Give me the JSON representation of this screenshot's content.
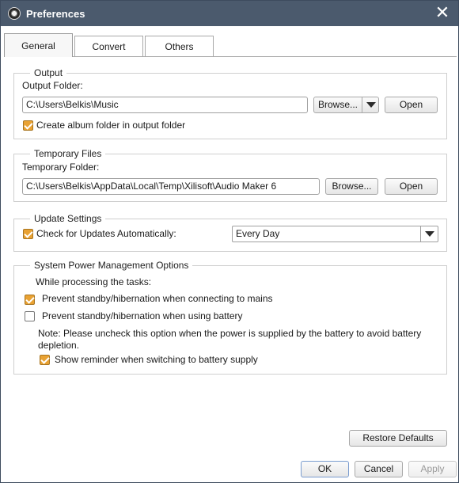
{
  "window": {
    "title": "Preferences"
  },
  "tabs": [
    {
      "label": "General",
      "active": true
    },
    {
      "label": "Convert",
      "active": false
    },
    {
      "label": "Others",
      "active": false
    }
  ],
  "output": {
    "legend": "Output",
    "folder_label": "Output Folder:",
    "folder_value": "C:\\Users\\Belkis\\Music",
    "browse_label": "Browse...",
    "open_label": "Open",
    "album_folder_label": "Create album folder in output folder",
    "album_folder_checked": true
  },
  "temp": {
    "legend": "Temporary Files",
    "folder_label": "Temporary Folder:",
    "folder_value": "C:\\Users\\Belkis\\AppData\\Local\\Temp\\Xilisoft\\Audio Maker 6",
    "browse_label": "Browse...",
    "open_label": "Open"
  },
  "updates": {
    "legend": "Update Settings",
    "check_label": "Check for Updates Automatically:",
    "check_checked": true,
    "frequency_value": "Every Day"
  },
  "power": {
    "legend": "System Power Management Options",
    "while_label": "While processing the tasks:",
    "mains_label": "Prevent standby/hibernation when connecting to mains",
    "mains_checked": true,
    "battery_label": "Prevent standby/hibernation when using battery",
    "battery_checked": false,
    "note_line1": "Note: Please uncheck this option when the power is supplied by the battery to avoid battery",
    "note_line2": "depletion.",
    "reminder_label": "Show reminder when switching to battery supply",
    "reminder_checked": true
  },
  "footer": {
    "restore_label": "Restore Defaults",
    "ok_label": "OK",
    "cancel_label": "Cancel",
    "apply_label": "Apply"
  },
  "colors": {
    "titlebar": "#4b5a6d",
    "checkbox_checked": "#e9a233"
  }
}
